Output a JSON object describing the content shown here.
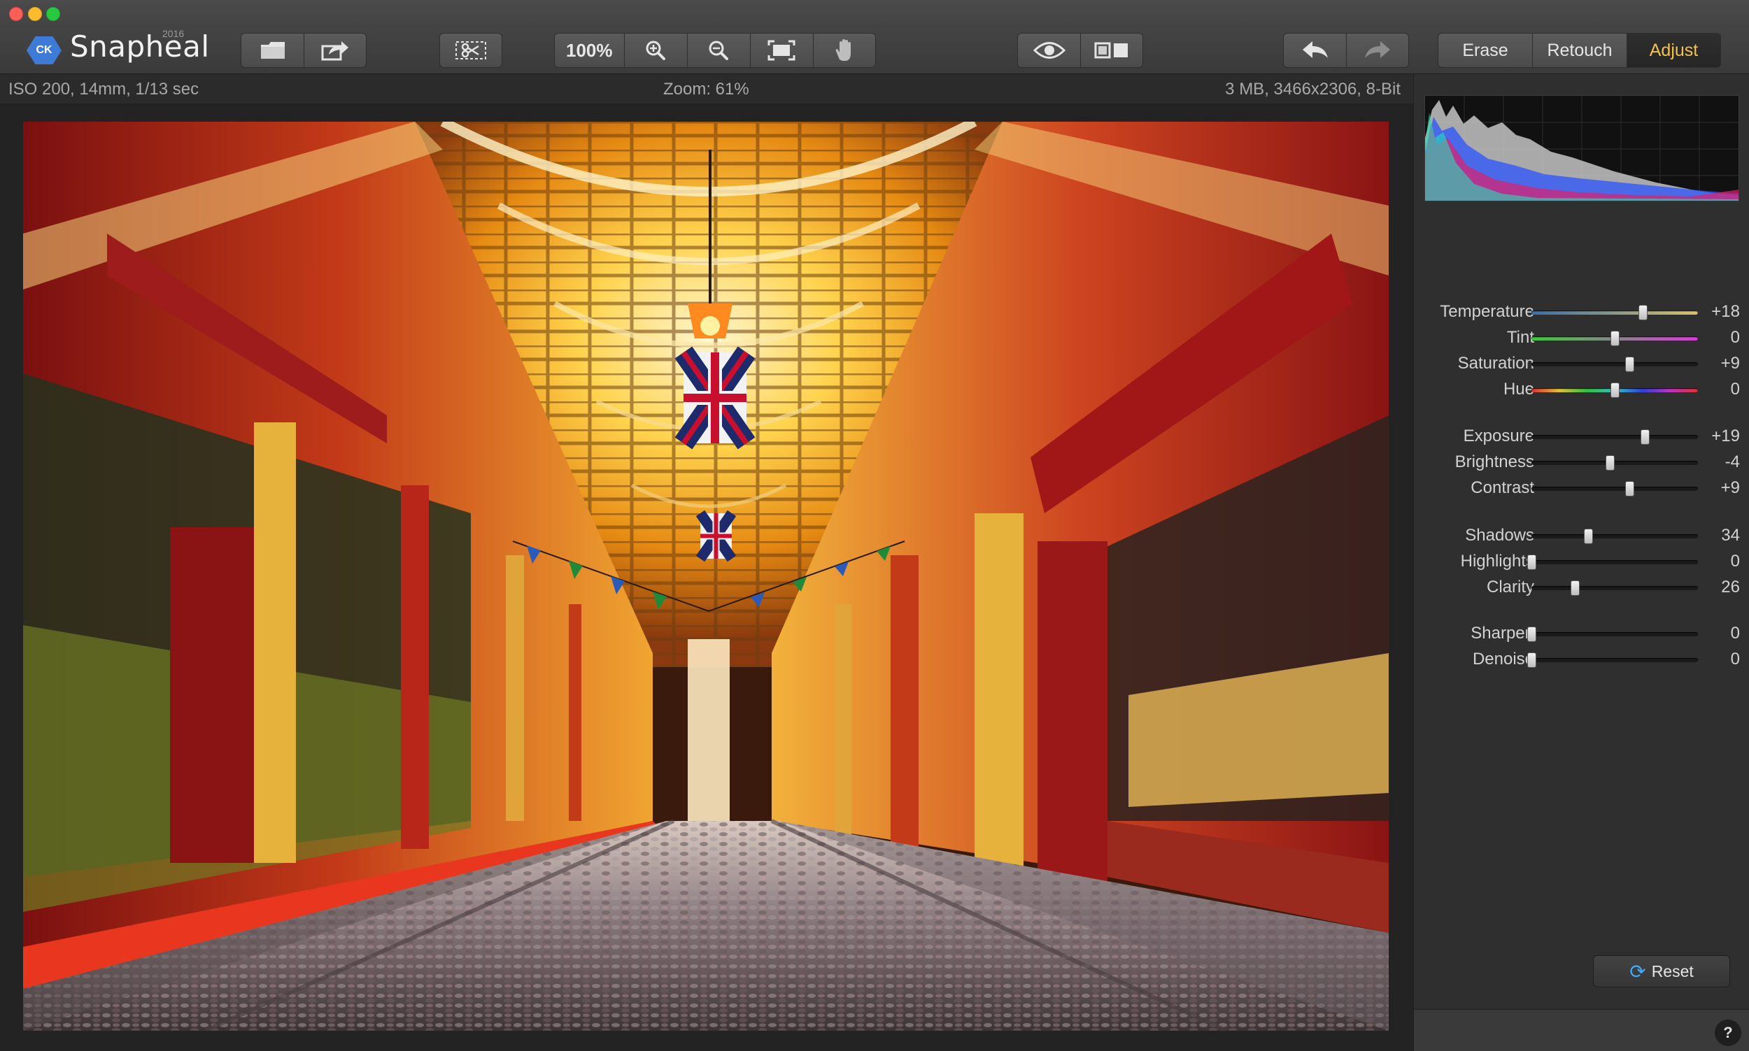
{
  "app": {
    "name": "Snapheal",
    "year": "2016",
    "badge": "CK"
  },
  "toolbar": {
    "zoom_100_label": "100%",
    "modes": [
      {
        "label": "Erase",
        "active": false
      },
      {
        "label": "Retouch",
        "active": false
      },
      {
        "label": "Adjust",
        "active": true
      }
    ]
  },
  "info": {
    "exif": "ISO 200, 14mm, 1/13 sec",
    "zoom": "Zoom: 61%",
    "file": "3 MB, 3466x2306, 8-Bit"
  },
  "adjust": {
    "sliders": [
      {
        "label": "Temperature",
        "value": "+18",
        "pos": 0.67,
        "track": "temperature"
      },
      {
        "label": "Tint",
        "value": "0",
        "pos": 0.5,
        "track": "tint"
      },
      {
        "label": "Saturation",
        "value": "+9",
        "pos": 0.59,
        "track": "plain"
      },
      {
        "label": "Hue",
        "value": "0",
        "pos": 0.5,
        "track": "hue"
      },
      {
        "label": "Exposure",
        "value": "+19",
        "pos": 0.68,
        "track": "plain"
      },
      {
        "label": "Brightness",
        "value": "-4",
        "pos": 0.47,
        "track": "plain"
      },
      {
        "label": "Contrast",
        "value": "+9",
        "pos": 0.59,
        "track": "plain"
      },
      {
        "label": "Shadows",
        "value": "34",
        "pos": 0.34,
        "track": "plain"
      },
      {
        "label": "Highlights",
        "value": "0",
        "pos": 0.0,
        "track": "plain"
      },
      {
        "label": "Clarity",
        "value": "26",
        "pos": 0.26,
        "track": "plain"
      },
      {
        "label": "Sharpen",
        "value": "0",
        "pos": 0.0,
        "track": "plain"
      },
      {
        "label": "Denoise",
        "value": "0",
        "pos": 0.0,
        "track": "plain"
      }
    ],
    "reset_label": "Reset"
  },
  "help_label": "?",
  "colors": {
    "accent": "#f3c24a",
    "temperature_track": [
      "#3b6ea8",
      "#d9c36a"
    ],
    "tint_track": [
      "#3ec93e",
      "#d63ed6"
    ]
  }
}
